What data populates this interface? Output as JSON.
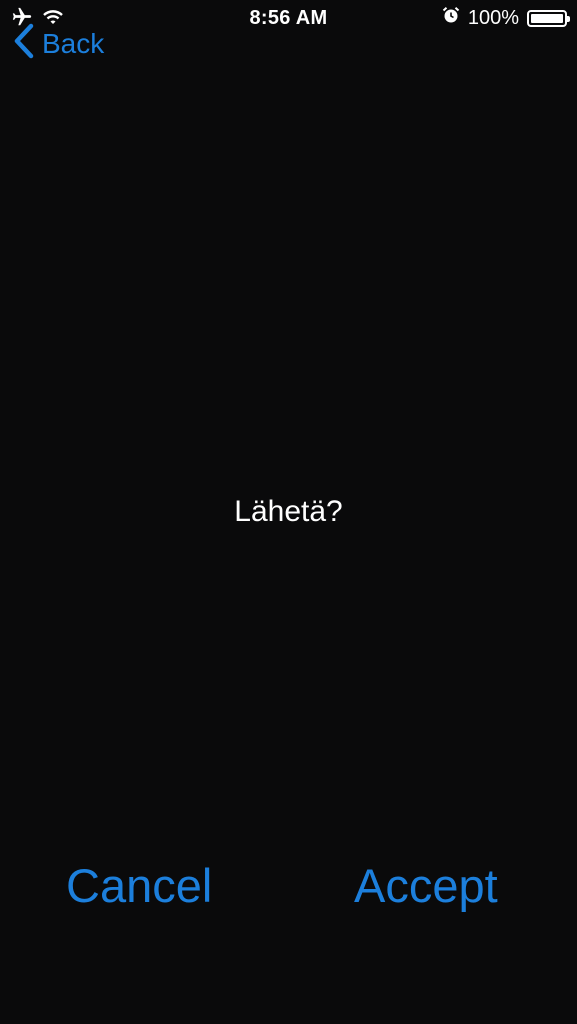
{
  "status_bar": {
    "time": "8:56 AM",
    "battery_percent": "100%",
    "battery_level": 1.0,
    "icons": [
      "airplane-icon",
      "wifi-icon",
      "alarm-icon",
      "battery-icon"
    ]
  },
  "nav": {
    "back_label": "Back"
  },
  "dialog": {
    "prompt": "Lähetä?",
    "cancel_label": "Cancel",
    "accept_label": "Accept"
  },
  "colors": {
    "background": "#0a0a0b",
    "accent": "#1c7fdc",
    "text": "#ffffff"
  }
}
